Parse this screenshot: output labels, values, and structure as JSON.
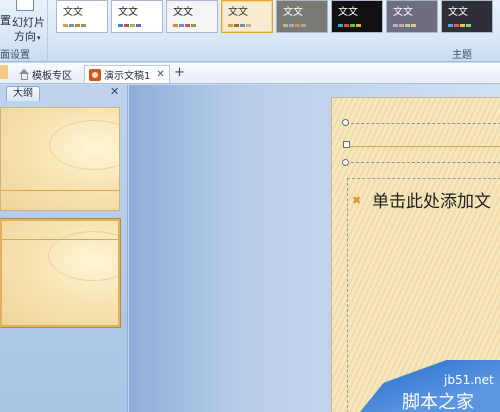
{
  "ribbon": {
    "orientation_button": {
      "label_line1": "幻灯片",
      "label_line2": "方向"
    },
    "left_stub_label_1": "置",
    "left_stub_label_2": "",
    "left_group_label": "面设置",
    "themes_group_label": "主题",
    "themes": [
      {
        "label": "文文",
        "bg": "#ffffff",
        "text": "#333333",
        "swatches": [
          "#c9a25a",
          "#6f8fb3",
          "#c47c3b",
          "#8aa05c"
        ]
      },
      {
        "label": "文文",
        "bg": "#ffffff",
        "text": "#222222",
        "swatches": [
          "#4f81bd",
          "#c0504d",
          "#9bbb59",
          "#8064a2"
        ]
      },
      {
        "label": "文文",
        "bg": "#f4f4f4",
        "text": "#222222",
        "swatches": [
          "#d38a2e",
          "#6a8fc3",
          "#c45a5a",
          "#7fa84c"
        ]
      },
      {
        "label": "文文",
        "bg": "#f7ecd2",
        "text": "#333333",
        "swatches": [
          "#e09f3e",
          "#9b6a3c",
          "#6f8fb3",
          "#c7b179"
        ]
      },
      {
        "label": "文文",
        "bg": "#7a7a74",
        "text": "#ffffff",
        "swatches": [
          "#c3b58a",
          "#9fb3c8",
          "#d48f5a",
          "#a8a8a8"
        ]
      },
      {
        "label": "文文",
        "bg": "#111111",
        "text": "#ffffff",
        "swatches": [
          "#3b9fe0",
          "#e0493b",
          "#64c24f",
          "#e0b23b"
        ]
      },
      {
        "label": "文文",
        "bg": "#6e6e80",
        "text": "#ffffff",
        "swatches": [
          "#a3b9d6",
          "#d6a3b9",
          "#b9d6a3",
          "#d6c8a3"
        ]
      },
      {
        "label": "文文",
        "bg": "#2f2f38",
        "text": "#ffffff",
        "swatches": [
          "#5a9ee8",
          "#e85a5a",
          "#e8c95a",
          "#7fd67f"
        ]
      }
    ],
    "selected_theme_index": 3
  },
  "tabs": [
    {
      "label": "模板专区",
      "active": false
    },
    {
      "label": "演示文稿1",
      "active": true
    }
  ],
  "tab_close": "✕",
  "tab_add": "+",
  "outline_pane": {
    "tab_label": "大纲",
    "close": "✕"
  },
  "slide": {
    "content_placeholder": "单击此处添加文"
  },
  "watermark": {
    "line1": "jb51.net",
    "line2": "脚本之家"
  },
  "colors": {
    "accent_line": "#e6a545",
    "slide_bg": "#f6e7be",
    "selection_border": "#e3b15d"
  }
}
